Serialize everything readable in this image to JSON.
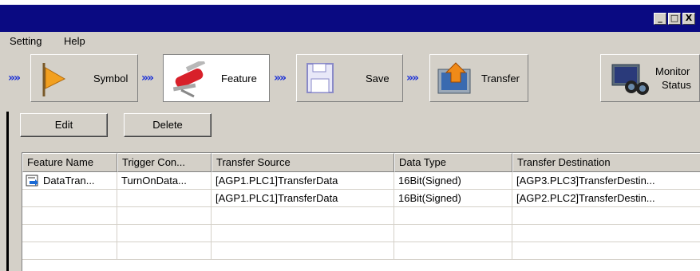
{
  "window": {
    "controls": [
      "_",
      "□",
      "X"
    ]
  },
  "menu": {
    "items": [
      "Setting",
      "Help"
    ]
  },
  "toolbar": {
    "steps": [
      {
        "label": "Symbol"
      },
      {
        "label": "Feature"
      },
      {
        "label": "Save"
      },
      {
        "label": "Transfer"
      }
    ],
    "monitor": {
      "line1": "Monitor",
      "line2": "Status"
    },
    "arrow": "»"
  },
  "actions": {
    "edit": "Edit",
    "delete": "Delete"
  },
  "table": {
    "headers": [
      "Feature Name",
      "Trigger Con...",
      "Transfer Source",
      "Data Type",
      "Transfer Destination"
    ],
    "rows": [
      [
        "DataTran...",
        "TurnOnData...",
        "[AGP1.PLC1]TransferData",
        "16Bit(Signed)",
        "[AGP3.PLC3]TransferDestin..."
      ],
      [
        "",
        "",
        "[AGP1.PLC1]TransferData",
        "16Bit(Signed)",
        "[AGP2.PLC2]TransferDestin..."
      ],
      [
        "",
        "",
        "",
        "",
        ""
      ],
      [
        "",
        "",
        "",
        "",
        ""
      ],
      [
        "",
        "",
        "",
        "",
        ""
      ]
    ]
  },
  "colors": {
    "titlebar": "#0a0a82",
    "arrow": "#1a2fd6",
    "face": "#d4d0c8"
  }
}
